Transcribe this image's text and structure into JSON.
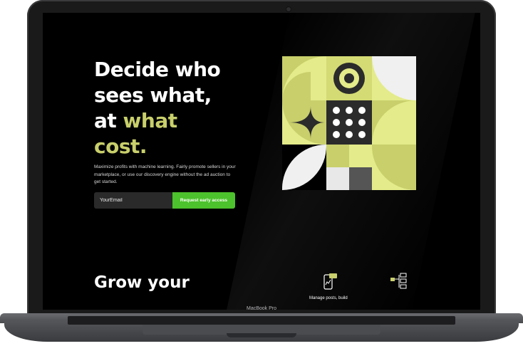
{
  "device": {
    "label": "MacBook Pro"
  },
  "hero": {
    "headline_line1": "Decide who",
    "headline_line2": "sees what,",
    "headline_line3_prefix": "at ",
    "headline_line3_accent": "what",
    "headline_line4_accent": "cost.",
    "description": "Maximize profits with machine learning. Fairly promote sellers in your marketplace, or use our discovery engine without the ad auction to get started.",
    "email_placeholder": "YourEmail",
    "cta_label": "Request early access"
  },
  "section2": {
    "heading": "Grow your",
    "feature1_text": "Manage posts, build",
    "feature1_icon": "phone-chart-icon",
    "feature2_icon": "flowchart-icon"
  },
  "colors": {
    "accent_text": "#c8cf6b",
    "cta_green": "#4cc22c",
    "art_yellow": "#e3eb8a",
    "art_olive": "#c8cf6b",
    "art_dark": "#2b2b2b"
  }
}
